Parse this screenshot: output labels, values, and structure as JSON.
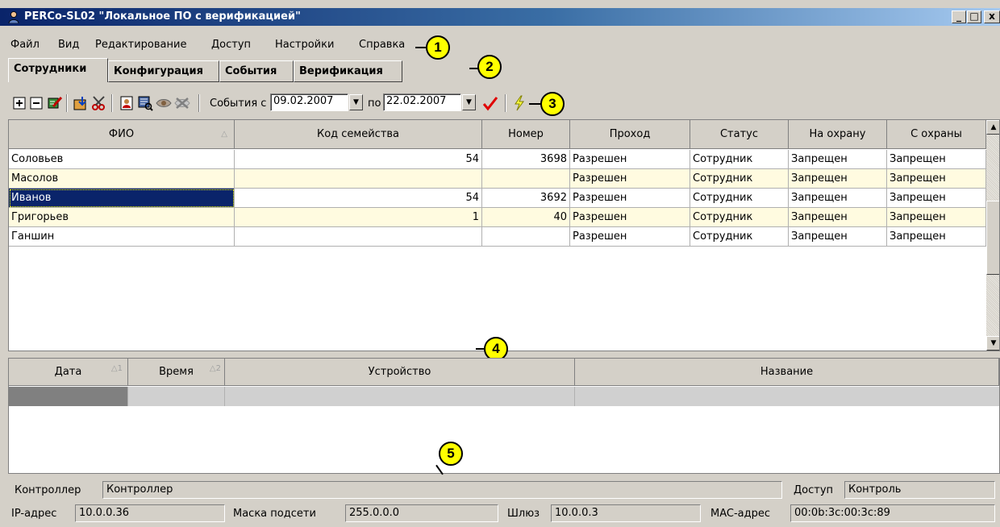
{
  "window": {
    "title": "PERCo-SL02 \"Локальное ПО с верификацией\"",
    "controls": [
      "_",
      "□",
      "x"
    ]
  },
  "menu": [
    "Файл",
    "Вид",
    "Редактирование",
    "Доступ",
    "Настройки",
    "Справка"
  ],
  "tabs": [
    {
      "label": "Сотрудники",
      "active": true
    },
    {
      "label": "Конфигурация",
      "active": false
    },
    {
      "label": "События",
      "active": false
    },
    {
      "label": "Верификация",
      "active": false
    }
  ],
  "callouts": [
    "1",
    "2",
    "3",
    "4",
    "5"
  ],
  "toolbar": {
    "icons": [
      "add-icon",
      "remove-icon",
      "edit-card-icon",
      "import-icon",
      "cut-icon",
      "photo-card-icon",
      "search-photo-icon",
      "eye-icon",
      "cancel-eye-icon"
    ],
    "events_from_label": "События с",
    "date_from": "09.02.2007",
    "to_label": "по",
    "date_to": "22.02.2007",
    "apply_icon": "checkmark-icon",
    "lightning_icon": "lightning-icon"
  },
  "employees": {
    "columns": [
      "ФИО",
      "Код семейства",
      "Номер",
      "Проход",
      "Статус",
      "На охрану",
      "С охраны"
    ],
    "rows": [
      {
        "fio": "Соловьев",
        "family": "54",
        "number": "3698",
        "pass": "Разрешен",
        "status": "Сотрудник",
        "arm": "Запрещен",
        "disarm": "Запрещен"
      },
      {
        "fio": "Масолов",
        "family": "",
        "number": "",
        "pass": "Разрешен",
        "status": "Сотрудник",
        "arm": "Запрещен",
        "disarm": "Запрещен"
      },
      {
        "fio": "Иванов",
        "family": "54",
        "number": "3692",
        "pass": "Разрешен",
        "status": "Сотрудник",
        "arm": "Запрещен",
        "disarm": "Запрещен"
      },
      {
        "fio": "Григорьев",
        "family": "1",
        "number": "40",
        "pass": "Разрешен",
        "status": "Сотрудник",
        "arm": "Запрещен",
        "disarm": "Запрещен"
      },
      {
        "fio": "Ганшин",
        "family": "",
        "number": "",
        "pass": "Разрешен",
        "status": "Сотрудник",
        "arm": "Запрещен",
        "disarm": "Запрещен"
      }
    ],
    "selected_index": 2
  },
  "events": {
    "columns": [
      "Дата",
      "Время",
      "Устройство",
      "Название"
    ],
    "sort_marks": [
      "1",
      "2"
    ]
  },
  "status": {
    "controller_label": "Контроллер",
    "controller_value": "Контроллер",
    "access_label": "Доступ",
    "access_value": "Контроль",
    "ip_label": "IP-адрес",
    "ip_value": "10.0.0.36",
    "mask_label": "Маска подсети",
    "mask_value": "255.0.0.0",
    "gateway_label": "Шлюз",
    "gateway_value": "10.0.0.3",
    "mac_label": "MAC-адрес",
    "mac_value": "00:0b:3c:00:3c:89"
  }
}
